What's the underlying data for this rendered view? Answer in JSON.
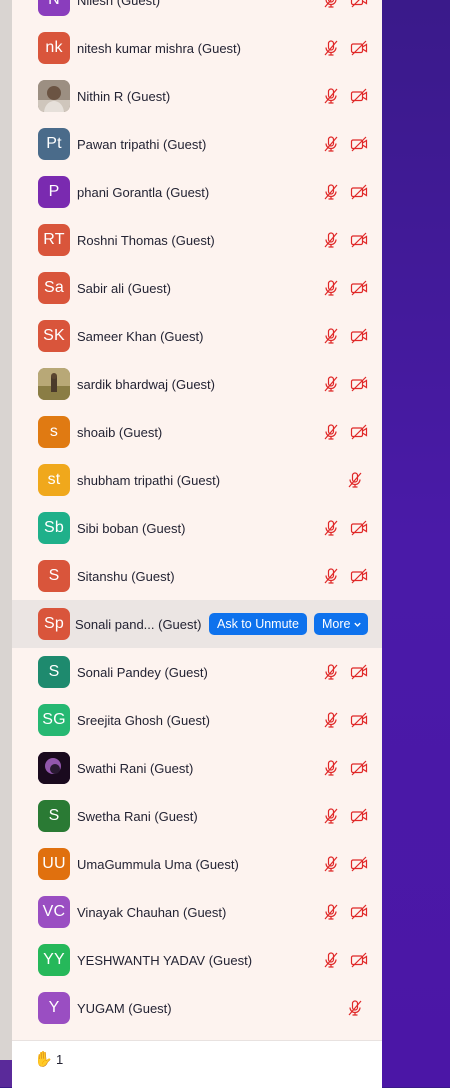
{
  "colors": {
    "panel_bg": "#fdf3ef",
    "muted_red": "#e02828",
    "button_blue": "#0e72ed",
    "highlight_row": "#ebe5e3"
  },
  "participants": [
    {
      "initials": "N",
      "name": "Nilesh (Guest)",
      "color": "#8a3dbd",
      "muted": true,
      "video_off": true
    },
    {
      "initials": "nk",
      "name": "nitesh kumar mishra (Guest)",
      "color": "#d9553b",
      "muted": true,
      "video_off": true
    },
    {
      "initials": "",
      "name": "Nithin R (Guest)",
      "color": "#a89b8c",
      "photo": true,
      "muted": true,
      "video_off": true
    },
    {
      "initials": "Pt",
      "name": "Pawan tripathi (Guest)",
      "color": "#4a6b8a",
      "muted": true,
      "video_off": true
    },
    {
      "initials": "P",
      "name": "phani Gorantla (Guest)",
      "color": "#7a2ab0",
      "muted": true,
      "video_off": true
    },
    {
      "initials": "RT",
      "name": "Roshni Thomas (Guest)",
      "color": "#d9553b",
      "muted": true,
      "video_off": true
    },
    {
      "initials": "Sa",
      "name": "Sabir ali (Guest)",
      "color": "#d9553b",
      "muted": true,
      "video_off": true
    },
    {
      "initials": "SK",
      "name": "Sameer Khan (Guest)",
      "color": "#d9553b",
      "muted": true,
      "video_off": true
    },
    {
      "initials": "",
      "name": "sardik bhardwaj (Guest)",
      "color": "#8a7a4a",
      "photo": true,
      "muted": true,
      "video_off": true
    },
    {
      "initials": "s",
      "name": "shoaib (Guest)",
      "color": "#e07a12",
      "muted": true,
      "video_off": true
    },
    {
      "initials": "st",
      "name": "shubham tripathi (Guest)",
      "color": "#f0a81c",
      "muted": true,
      "video_off": false
    },
    {
      "initials": "Sb",
      "name": "Sibi boban (Guest)",
      "color": "#1fb08a",
      "muted": true,
      "video_off": true
    },
    {
      "initials": "S",
      "name": "Sitanshu (Guest)",
      "color": "#d9553b",
      "muted": true,
      "video_off": true
    },
    {
      "initials": "Sp",
      "name": "Sonali pand...",
      "suffix": "(Guest)",
      "color": "#d9553b",
      "highlight": true
    },
    {
      "initials": "S",
      "name": "Sonali Pandey (Guest)",
      "color": "#1e8a6e",
      "muted": true,
      "video_off": true
    },
    {
      "initials": "SG",
      "name": "Sreejita Ghosh (Guest)",
      "color": "#26b872",
      "muted": true,
      "video_off": true
    },
    {
      "initials": "",
      "name": "Swathi Rani (Guest)",
      "color": "#3a1a4a",
      "photo": true,
      "muted": true,
      "video_off": true
    },
    {
      "initials": "S",
      "name": "Swetha Rani (Guest)",
      "color": "#2a7a34",
      "muted": true,
      "video_off": true
    },
    {
      "initials": "UU",
      "name": "UmaGummula Uma (Guest)",
      "color": "#e0700e",
      "muted": true,
      "video_off": true
    },
    {
      "initials": "VC",
      "name": "Vinayak Chauhan (Guest)",
      "color": "#9a4ec2",
      "muted": true,
      "video_off": true
    },
    {
      "initials": "YY",
      "name": "YESHWANTH YADAV (Guest)",
      "color": "#26b85a",
      "muted": true,
      "video_off": true
    },
    {
      "initials": "Y",
      "name": "YUGAM (Guest)",
      "color": "#9a4ec2",
      "muted": true,
      "video_off": false
    }
  ],
  "highlight_actions": {
    "ask_to_unmute": "Ask to Unmute",
    "more": "More"
  },
  "footer": {
    "hand_icon": "raised-hand-icon",
    "hand_glyph": "✋",
    "count": "1"
  }
}
